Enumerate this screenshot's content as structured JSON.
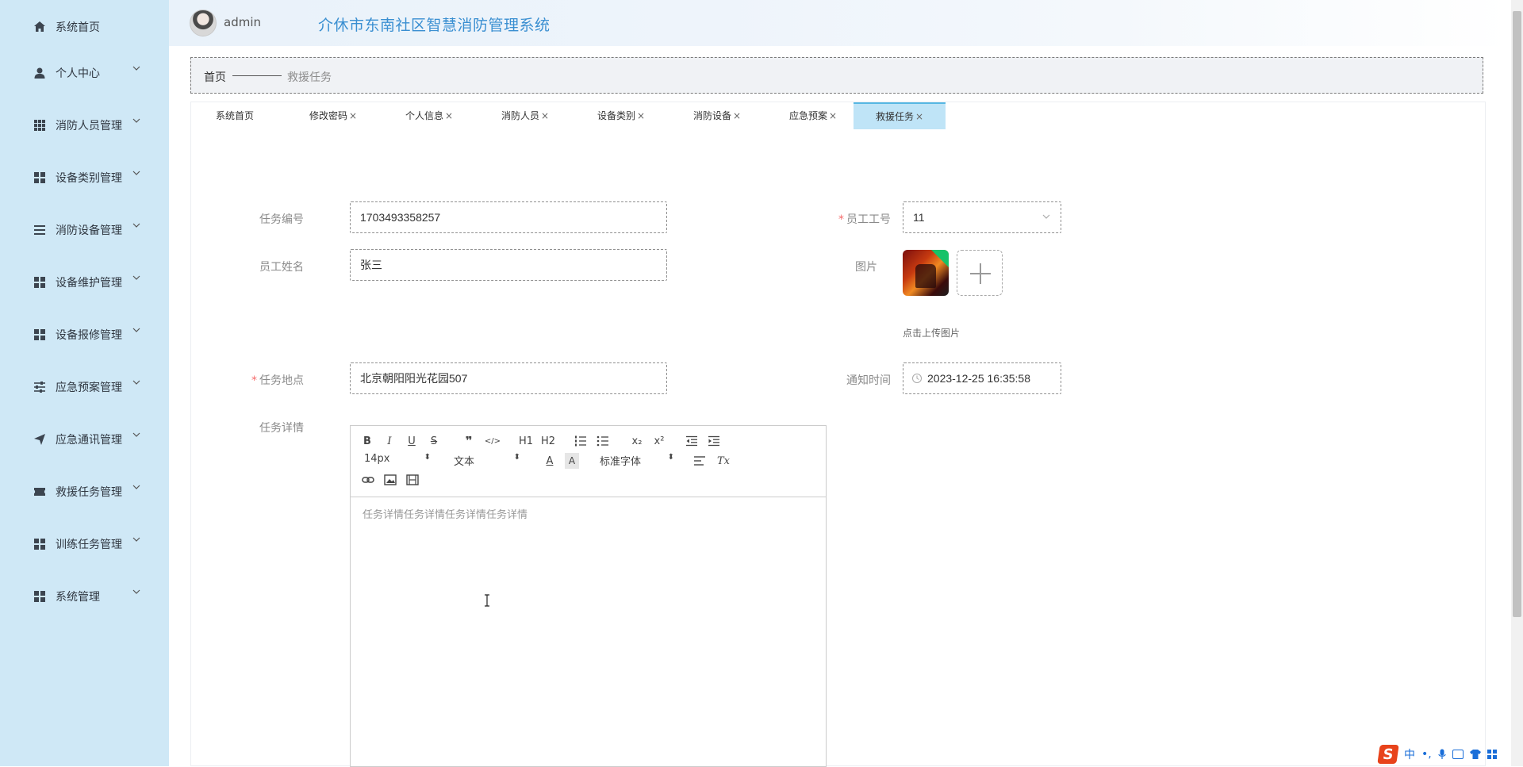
{
  "sidebar": {
    "items": [
      {
        "label": "系统首页",
        "icon": "home-icon",
        "has_submenu": false
      },
      {
        "label": "个人中心",
        "icon": "user-icon",
        "has_submenu": true
      },
      {
        "label": "消防人员管理",
        "icon": "grid-icon",
        "has_submenu": true
      },
      {
        "label": "设备类别管理",
        "icon": "grid-icon",
        "has_submenu": true
      },
      {
        "label": "消防设备管理",
        "icon": "list-icon",
        "has_submenu": true
      },
      {
        "label": "设备维护管理",
        "icon": "grid-icon",
        "has_submenu": true
      },
      {
        "label": "设备报修管理",
        "icon": "grid-icon",
        "has_submenu": true
      },
      {
        "label": "应急预案管理",
        "icon": "sliders-icon",
        "has_submenu": true
      },
      {
        "label": "应急通讯管理",
        "icon": "send-icon",
        "has_submenu": true
      },
      {
        "label": "救援任务管理",
        "icon": "ticket-icon",
        "has_submenu": true
      },
      {
        "label": "训练任务管理",
        "icon": "grid-icon",
        "has_submenu": true
      },
      {
        "label": "系统管理",
        "icon": "grid-icon",
        "has_submenu": true
      }
    ]
  },
  "header": {
    "username": "admin",
    "app_title": "介休市东南社区智慧消防管理系统"
  },
  "breadcrumb": {
    "home": "首页",
    "current": "救援任务"
  },
  "tabs": [
    {
      "label": "系统首页",
      "closable": false,
      "active": false
    },
    {
      "label": "修改密码",
      "closable": true,
      "active": false
    },
    {
      "label": "个人信息",
      "closable": true,
      "active": false
    },
    {
      "label": "消防人员",
      "closable": true,
      "active": false
    },
    {
      "label": "设备类别",
      "closable": true,
      "active": false
    },
    {
      "label": "消防设备",
      "closable": true,
      "active": false
    },
    {
      "label": "应急预案",
      "closable": true,
      "active": false
    },
    {
      "label": "救援任务",
      "closable": true,
      "active": true
    }
  ],
  "tab_close_glyph": "×",
  "form": {
    "task_no": {
      "label": "任务编号",
      "value": "1703493358257"
    },
    "employee_no": {
      "label": "员工工号",
      "value": "11",
      "required": true
    },
    "employee_name": {
      "label": "员工姓名",
      "value": "张三"
    },
    "image": {
      "label": "图片",
      "upload_tip": "点击上传图片"
    },
    "task_location": {
      "label": "任务地点",
      "value": "北京朝阳阳光花园507",
      "required": true
    },
    "notify_time": {
      "label": "通知时间",
      "value": "2023-12-25 16:35:58"
    },
    "task_detail": {
      "label": "任务详情",
      "content": "任务详情任务详情任务详情任务详情"
    },
    "required_mark": "*"
  },
  "editor_toolbar": {
    "bold": "B",
    "italic": "I",
    "underline": "U",
    "strike": "S",
    "blockquote": "❞",
    "code": "</>",
    "h1": "H1",
    "h2": "H2",
    "subscript": "x₂",
    "superscript": "x²",
    "font_size": "14px",
    "header_select": "文本",
    "font_family": "标准字体",
    "text_color": "A",
    "bg_color": "A",
    "clean": "Tx",
    "select_arrow": "⬍"
  },
  "ime": {
    "logo": "S",
    "lang": "中",
    "punct": "•,"
  },
  "colors": {
    "sidebar_bg": "#cfe8f6",
    "title": "#3a8fd1",
    "active_tab": "#bfe4f7",
    "required": "#f56c6c"
  }
}
